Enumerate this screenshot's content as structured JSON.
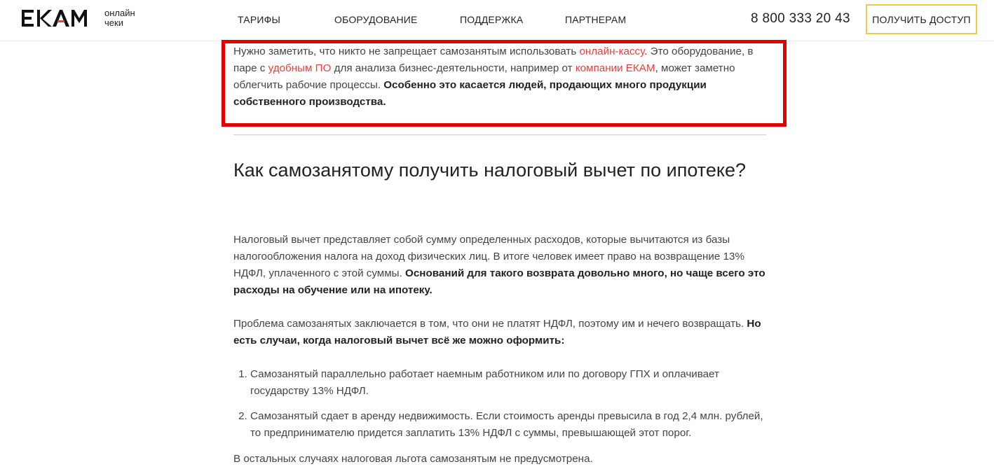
{
  "header": {
    "logo_text": "EKAM",
    "logo_sub_line1": "онлайн",
    "logo_sub_line2": "чеки",
    "nav": [
      "ТАРИФЫ",
      "ОБОРУДОВАНИЕ",
      "ПОДДЕРЖКА",
      "ПАРТНЕРАМ"
    ],
    "phone": "8 800 333 20 43",
    "cta_label": "ПОЛУЧИТЬ ДОСТУП"
  },
  "highlight_paragraph": {
    "part1": "Нужно заметить, что никто не запрещает самозанятым использовать ",
    "link1": "онлайн-кассу",
    "part2": ". Это оборудование, в паре с ",
    "link2": "удобным ПО",
    "part3": " для анализа бизнес-деятельности, например от ",
    "link3": "компании ЕКАМ",
    "part4": ", может заметно облегчить рабочие процессы. ",
    "bold": "Особенно это касается людей, продающих много продукции собственного производства."
  },
  "section": {
    "heading": "Как самозанятому получить налоговый вычет по ипотеке?",
    "p1_text": "Налоговый вычет представляет собой сумму определенных расходов, которые вычитаются из базы налогообложения налога на доход физических лиц. В итоге человек имеет право на возвращение 13% НДФЛ, уплаченного с этой суммы. ",
    "p1_bold": "Оснований для такого возврата довольно много, но чаще всего это расходы на обучение или на ипотеку.",
    "p2_text": "Проблема самозанятых заключается в том, что они не платят НДФЛ, поэтому им и нечего возвращать. ",
    "p2_bold": "Но есть случаи, когда налоговый вычет всё же можно оформить:",
    "list": [
      "Самозанятый параллельно работает наемным работником или по договору ГПХ и оплачивает государству 13% НДФЛ.",
      "Самозанятый сдает в аренду недвижимость. Если стоимость аренды превысила в год 2,4 млн. рублей, то предпринимателю придется заплатить 13% НДФЛ с суммы, превышающей этот порог."
    ],
    "p3_text": "В остальных случаях налоговая льгота самозанятым не предусмотрена."
  },
  "colors": {
    "accent_link": "#e8413c",
    "highlight_frame": "#e60000",
    "cta_border": "#f2c94c"
  }
}
